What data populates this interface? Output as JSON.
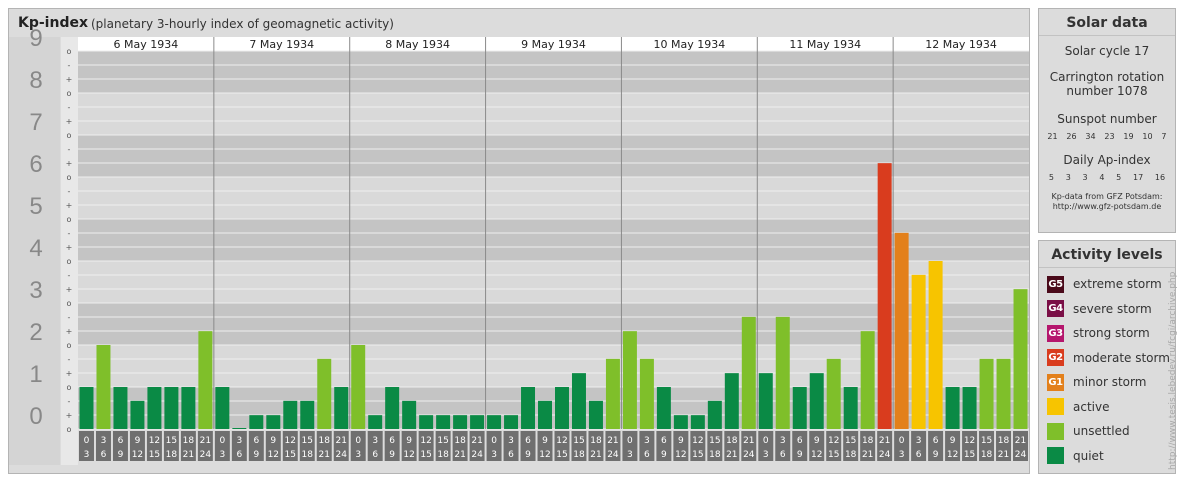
{
  "chart_data": {
    "type": "bar",
    "title": "Kp-index",
    "subtitle": "(planetary 3-hourly index of geomagnetic activity)",
    "ylim": [
      0,
      9
    ],
    "y_ticks": [
      "0",
      "1",
      "2",
      "3",
      "4",
      "5",
      "6",
      "7",
      "8",
      "9"
    ],
    "y_minor_ticks": [
      "o",
      "+",
      "-"
    ],
    "days": [
      "6 May 1934",
      "7 May 1934",
      "8 May 1934",
      "9 May 1934",
      "10 May 1934",
      "11 May 1934",
      "12 May 1934"
    ],
    "intervals": [
      [
        "0",
        "3"
      ],
      [
        "3",
        "6"
      ],
      [
        "6",
        "9"
      ],
      [
        "9",
        "12"
      ],
      [
        "12",
        "15"
      ],
      [
        "15",
        "18"
      ],
      [
        "18",
        "21"
      ],
      [
        "21",
        "24"
      ]
    ],
    "values": [
      [
        1,
        2,
        1,
        0.67,
        1,
        1,
        1,
        2.33
      ],
      [
        1,
        0,
        0.33,
        0.33,
        0.67,
        0.67,
        1.67,
        1
      ],
      [
        2,
        0.33,
        1,
        0.67,
        0.33,
        0.33,
        0.33,
        0.33
      ],
      [
        0.33,
        0.33,
        1,
        0.67,
        1,
        1.33,
        0.67,
        1.67
      ],
      [
        2.33,
        1.67,
        1,
        0.33,
        0.33,
        0.67,
        1.33,
        2.67
      ],
      [
        1.33,
        2.67,
        1,
        1.33,
        1.67,
        1,
        2.33,
        6.33
      ],
      [
        4.67,
        3.67,
        4,
        1,
        1,
        1.67,
        1.67,
        3.33
      ]
    ],
    "grid": true
  },
  "solar_data": {
    "header": "Solar data",
    "solar_cycle": "Solar cycle 17",
    "carrington_1": "Carrington rotation",
    "carrington_2": "number 1078",
    "sunspot_label": "Sunspot number",
    "sunspot_numbers": [
      "21",
      "26",
      "34",
      "23",
      "19",
      "10",
      "7"
    ],
    "ap_label": "Daily Ap-index",
    "ap_values": [
      "5",
      "3",
      "3",
      "4",
      "5",
      "17",
      "16"
    ],
    "credit_1": "Kp-data from GFZ Potsdam:",
    "credit_2": "http://www.gfz-potsdam.de"
  },
  "activity_levels": {
    "header": "Activity levels",
    "items": [
      {
        "badge": "G5",
        "label": "extreme storm",
        "color": "#4a0a1a"
      },
      {
        "badge": "G4",
        "label": "severe storm",
        "color": "#7a0f46"
      },
      {
        "badge": "G3",
        "label": "strong storm",
        "color": "#b5166d"
      },
      {
        "badge": "G2",
        "label": "moderate storm",
        "color": "#d93c1e"
      },
      {
        "badge": "G1",
        "label": "minor storm",
        "color": "#e3801b"
      },
      {
        "badge": "",
        "label": "active",
        "color": "#f7c400"
      },
      {
        "badge": "",
        "label": "unsettled",
        "color": "#7fbf2a"
      },
      {
        "badge": "",
        "label": "quiet",
        "color": "#0a8a45"
      }
    ]
  },
  "watermark": "http://www.tesis.lebedev.ru/fcgi/archive.php"
}
